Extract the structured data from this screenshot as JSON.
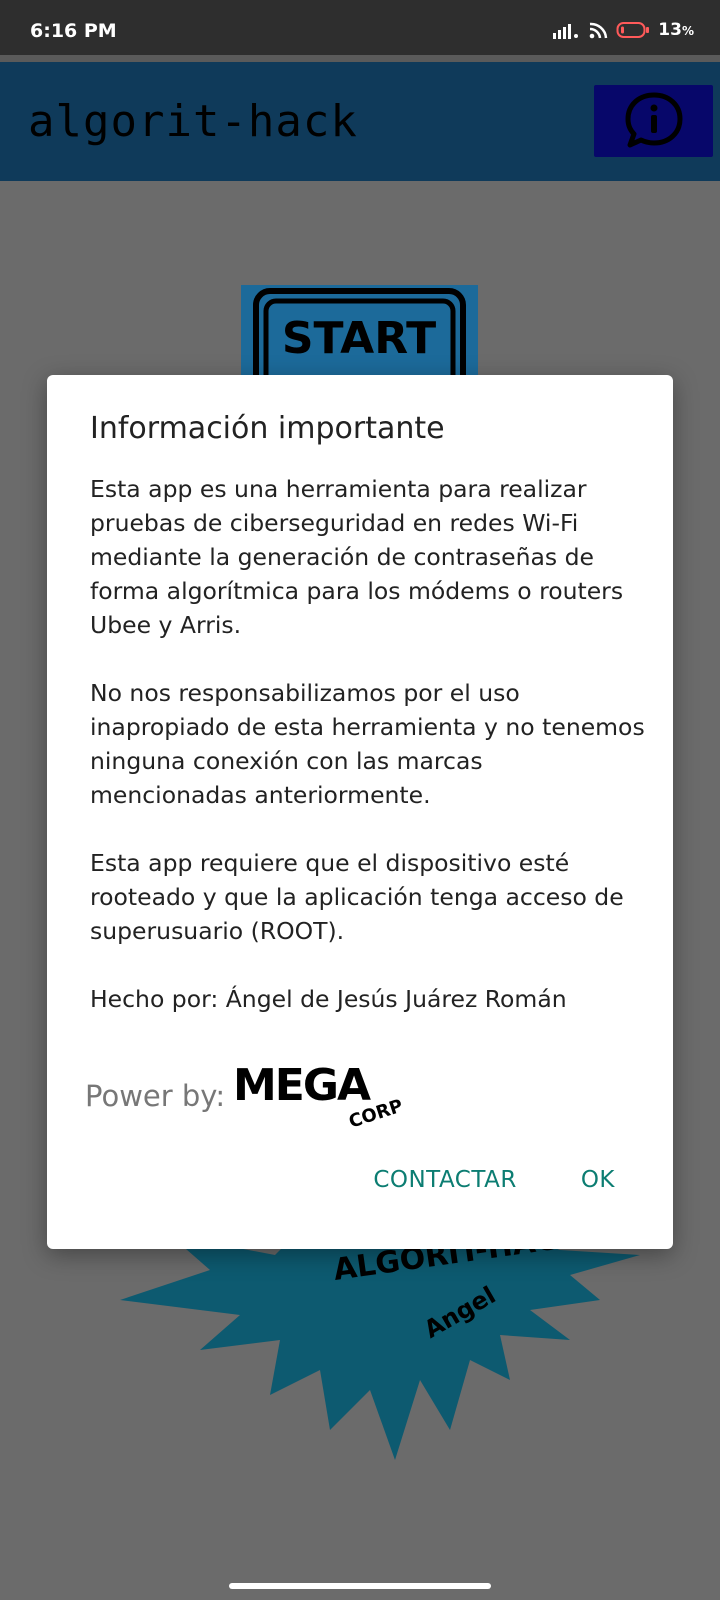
{
  "status_bar": {
    "time": "6:16 PM",
    "battery": "13",
    "battery_unit": "%",
    "icons": [
      "signal-icon",
      "wifi-icon",
      "battery-icon"
    ]
  },
  "app_bar": {
    "title": "algorit-hack",
    "info_icon": "info-chat-icon"
  },
  "start_button": {
    "label": "START"
  },
  "background_logo": {
    "text": "ALGORIT-HACK",
    "subtext": "Angel"
  },
  "dialog": {
    "title": "Información importante",
    "paragraphs": [
      "Esta app es una herramienta para realizar pruebas de ciberseguridad en redes Wi-Fi mediante la generación de contraseñas de forma algorítmica para los módems o routers Ubee y Arris.",
      "No nos responsabilizamos por el uso inapropiado de esta herramienta y no tenemos ninguna conexión con las marcas mencionadas anteriormente.",
      "Esta app requiere que el dispositivo esté rooteado y que la aplicación tenga acceso de superusuario (ROOT).",
      "Hecho por: Ángel de Jesús Juárez Román"
    ],
    "power_label": "Power by:",
    "power_logo_main": "MEGA",
    "power_logo_sub": "CORP",
    "buttons": {
      "contact": "CONTACTAR",
      "ok": "OK"
    }
  },
  "colors": {
    "app_bar": "#0f3a5a",
    "info_button": "#07076a",
    "accent": "#0c7d72",
    "scrim": "#6b6b6b",
    "burst": "#0d5a70"
  }
}
